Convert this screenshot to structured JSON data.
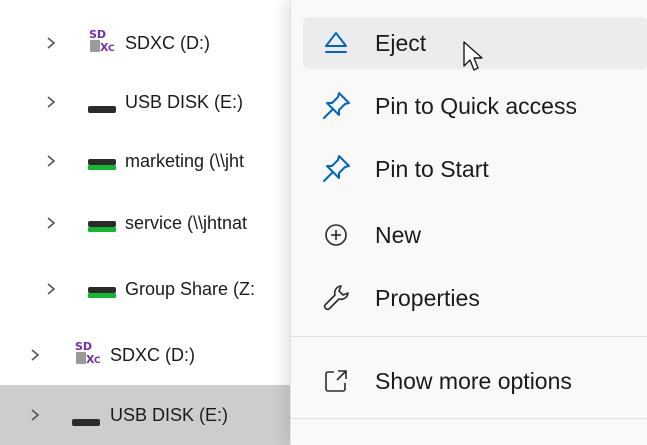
{
  "tree": {
    "items": [
      {
        "label": "SDXC (D:)",
        "icon": "sd-card-icon"
      },
      {
        "label": "USB DISK (E:)",
        "icon": "usb-drive-icon"
      },
      {
        "label": "marketing (\\\\jht",
        "icon": "network-drive-icon"
      },
      {
        "label": "service (\\\\jhtnat",
        "icon": "network-drive-icon"
      },
      {
        "label": "Group Share (Z:",
        "icon": "network-drive-icon"
      },
      {
        "label": "SDXC (D:)",
        "icon": "sd-card-icon"
      },
      {
        "label": "USB DISK (E:)",
        "icon": "usb-drive-icon",
        "selected": true
      }
    ]
  },
  "menu": {
    "items": [
      {
        "label": "Eject",
        "icon": "eject-icon",
        "hovered": true
      },
      {
        "label": "Pin to Quick access",
        "icon": "pin-icon"
      },
      {
        "label": "Pin to Start",
        "icon": "pin-icon"
      },
      {
        "label": "New",
        "icon": "plus-circle-icon"
      },
      {
        "label": "Properties",
        "icon": "wrench-icon"
      },
      {
        "label": "Show more options",
        "icon": "open-external-icon"
      }
    ]
  },
  "colors": {
    "accent": "#0067c0",
    "selected_row": "#cdcdcd",
    "menu_bg": "#f9f9f9",
    "menu_hover": "#ececec",
    "drive_green": "#16b532"
  }
}
